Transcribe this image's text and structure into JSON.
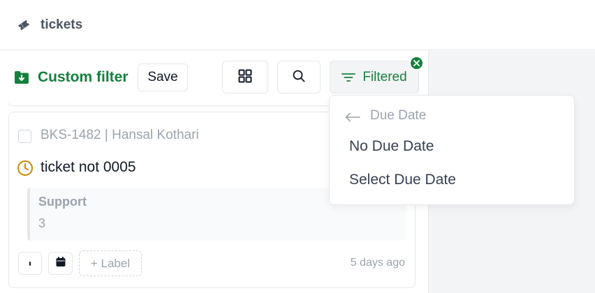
{
  "header": {
    "title": "tickets",
    "icon": "ticket-tag-icon"
  },
  "toolbar": {
    "filter_name": "Custom filter",
    "save_label": "Save",
    "filtered_label": "Filtered",
    "accent_color": "#15803d"
  },
  "card": {
    "ticket_id": "BKS-1482",
    "separator": "|",
    "assignee": "Hansal Kothari",
    "title": "ticket not 0005",
    "quote_title": "Support",
    "quote_value": "3",
    "label_button": "+ Label",
    "age": "5 days ago"
  },
  "dropdown": {
    "header": "Due Date",
    "items": [
      "No Due Date",
      "Select Due Date"
    ]
  }
}
